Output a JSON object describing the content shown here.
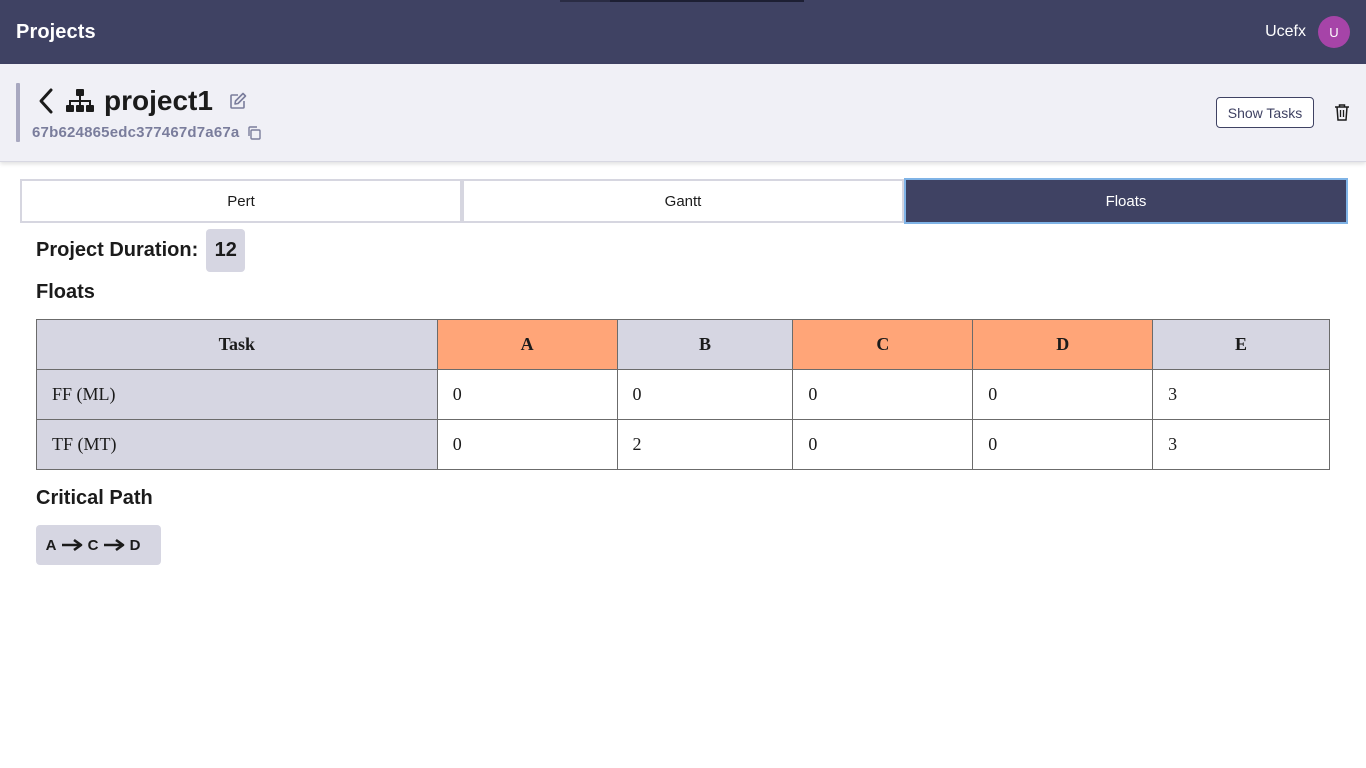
{
  "header": {
    "brand": "Projects",
    "username": "Ucefx",
    "avatar_initial": "U",
    "avatar_color": "#a644a8",
    "bar_color": "#3f4263"
  },
  "project": {
    "name": "project1",
    "id": "67b624865edc377467d7a67a",
    "show_tasks_label": "Show Tasks",
    "icons": [
      "back-icon",
      "sitemap-icon",
      "edit-icon",
      "copy-icon",
      "trash-icon"
    ]
  },
  "tabs": [
    {
      "label": "Pert",
      "active": false
    },
    {
      "label": "Gantt",
      "active": false
    },
    {
      "label": "Floats",
      "active": true
    }
  ],
  "duration": {
    "label": "Project Duration:",
    "value": "12"
  },
  "floats": {
    "title": "Floats",
    "header": [
      "Task",
      "A",
      "B",
      "C",
      "D",
      "E"
    ],
    "critical_tasks": [
      "A",
      "C",
      "D"
    ],
    "critical_color": "#ffa578",
    "rows": [
      {
        "label": "FF (ML)",
        "values": [
          "0",
          "0",
          "0",
          "0",
          "3"
        ]
      },
      {
        "label": "TF (MT)",
        "values": [
          "0",
          "2",
          "0",
          "0",
          "3"
        ]
      }
    ]
  },
  "critical_path": {
    "title": "Critical Path",
    "nodes": [
      "A",
      "C",
      "D"
    ]
  }
}
